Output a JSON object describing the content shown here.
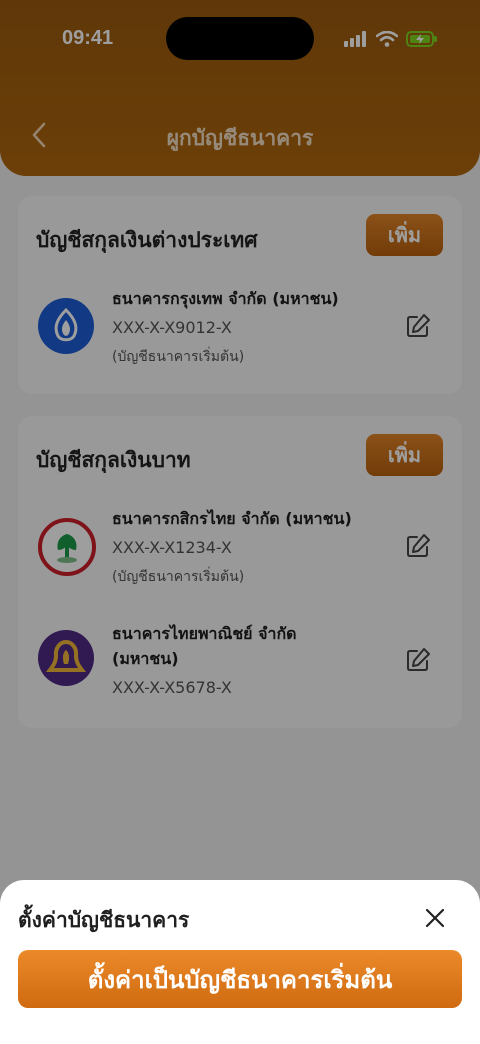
{
  "status_bar": {
    "time": "09:41"
  },
  "header": {
    "title": "ผูกบัญชีธนาคาร"
  },
  "foreign_section": {
    "title": "บัญชีสกุลเงินต่างประเทศ",
    "add_label": "เพิ่ม",
    "accounts": [
      {
        "bank_name": "ธนาคารกรุงเทพ จำกัด (มหาชน)",
        "account_no": "XXX-X-X9012-X",
        "default_label": "(บัญชีธนาคารเริ่มต้น)",
        "logo_color": "#1e5cd6"
      }
    ]
  },
  "baht_section": {
    "title": "บัญชีสกุลเงินบาท",
    "add_label": "เพิ่ม",
    "accounts": [
      {
        "bank_name": "ธนาคารกสิกรไทย จำกัด (มหาชน)",
        "account_no": "XXX-X-X1234-X",
        "default_label": "(บัญชีธนาคารเริ่มต้น)",
        "logo_color": "#cc1f2a"
      },
      {
        "bank_name_line1": "ธนาคารไทยพาณิชย์ จำกัด",
        "bank_name_line2": "(มหาชน)",
        "account_no": "XXX-X-X5678-X",
        "logo_color": "#4e2a84"
      }
    ]
  },
  "bottom_sheet": {
    "title": "ตั้งค่าบัญชีธนาคาร",
    "primary_label": "ตั้งค่าเป็นบัญชีธนาคารเริ่มต้น"
  },
  "colors": {
    "brand": "#b0660e",
    "accent": "#e08428"
  }
}
